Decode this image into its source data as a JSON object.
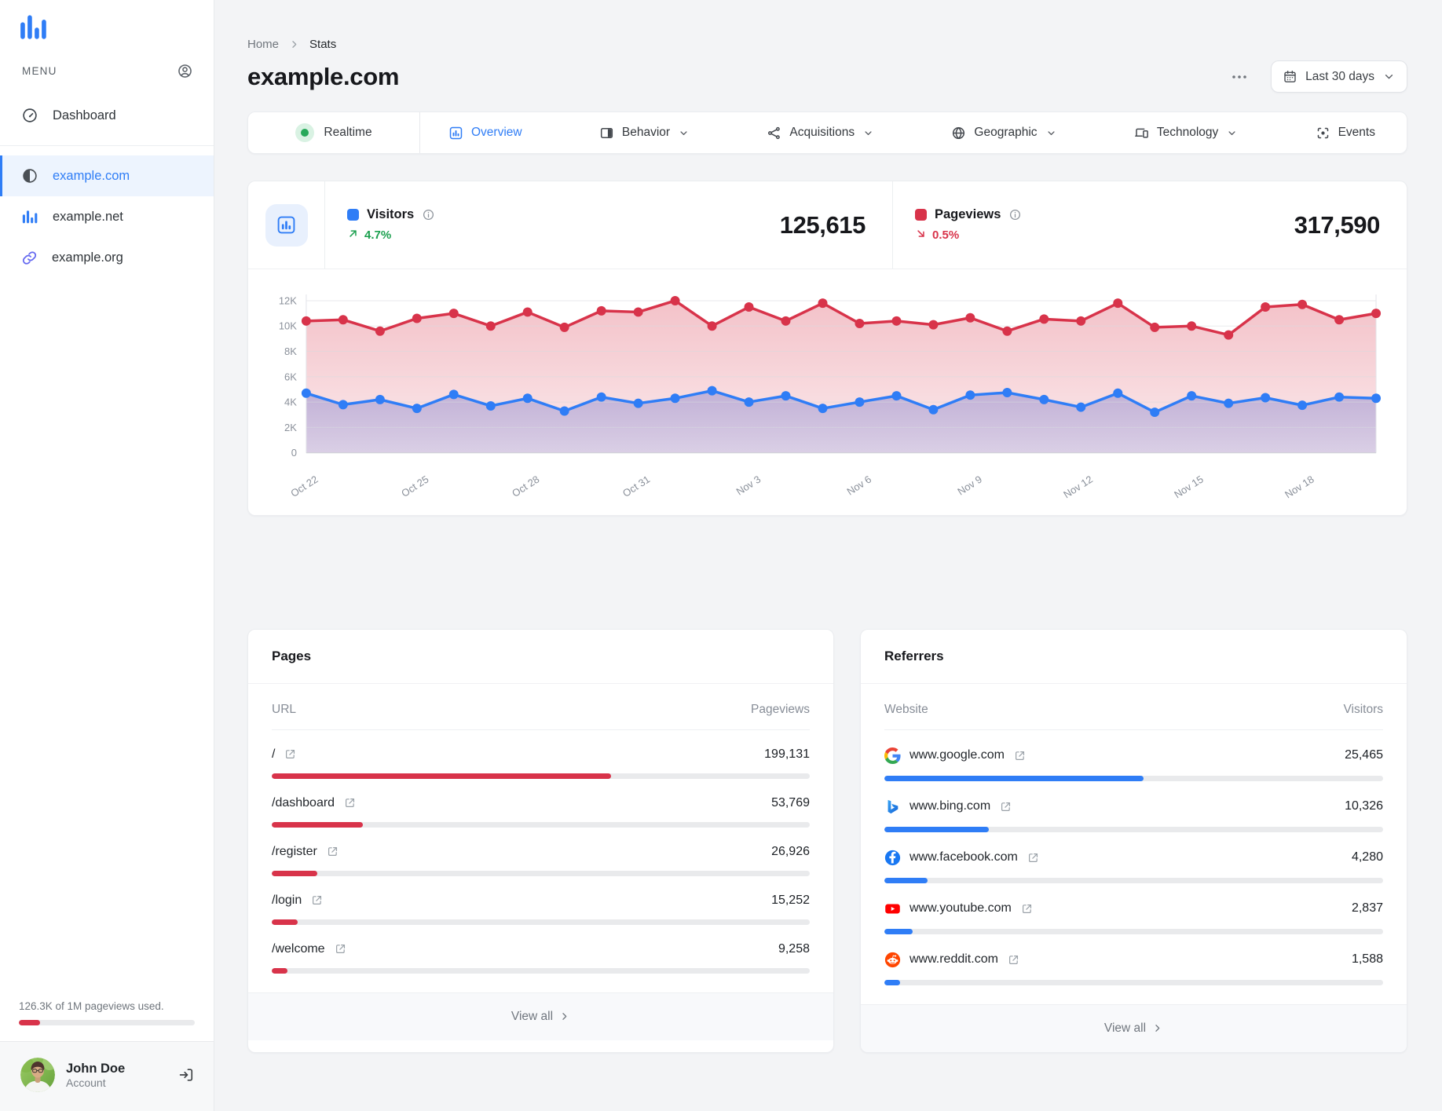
{
  "sidebar": {
    "menu_label": "MENU",
    "dashboard": "Dashboard",
    "sites": [
      {
        "label": "example.com",
        "icon": "contrast",
        "active": true
      },
      {
        "label": "example.net",
        "icon": "bar-chart",
        "active": false
      },
      {
        "label": "example.org",
        "icon": "link",
        "active": false
      }
    ],
    "usage_text": "126.3K of 1M pageviews used.",
    "usage_percent": 12,
    "account_name": "John Doe",
    "account_sub": "Account"
  },
  "breadcrumb": {
    "home": "Home",
    "current": "Stats"
  },
  "header": {
    "title": "example.com",
    "date_range": "Last 30 days"
  },
  "tabs": [
    {
      "label": "Realtime",
      "icon": "live",
      "active": false,
      "dropdown": false
    },
    {
      "label": "Overview",
      "icon": "overview",
      "active": true,
      "dropdown": false
    },
    {
      "label": "Behavior",
      "icon": "window",
      "active": false,
      "dropdown": true
    },
    {
      "label": "Acquisitions",
      "icon": "share",
      "active": false,
      "dropdown": true
    },
    {
      "label": "Geographic",
      "icon": "globe",
      "active": false,
      "dropdown": true
    },
    {
      "label": "Technology",
      "icon": "devices",
      "active": false,
      "dropdown": true
    },
    {
      "label": "Events",
      "icon": "scan",
      "active": false,
      "dropdown": false
    }
  ],
  "stats": {
    "visitors_label": "Visitors",
    "visitors_value": "125,615",
    "visitors_change": "4.7%",
    "visitors_direction": "up",
    "pageviews_label": "Pageviews",
    "pageviews_value": "317,590",
    "pageviews_change": "0.5%",
    "pageviews_direction": "down"
  },
  "chart_data": {
    "type": "line",
    "x": [
      "Oct 22",
      "Oct 23",
      "Oct 24",
      "Oct 25",
      "Oct 26",
      "Oct 27",
      "Oct 28",
      "Oct 29",
      "Oct 30",
      "Oct 31",
      "Nov 1",
      "Nov 2",
      "Nov 3",
      "Nov 4",
      "Nov 5",
      "Nov 6",
      "Nov 7",
      "Nov 8",
      "Nov 9",
      "Nov 10",
      "Nov 11",
      "Nov 12",
      "Nov 13",
      "Nov 14",
      "Nov 15",
      "Nov 16",
      "Nov 17",
      "Nov 18",
      "Nov 19",
      "Nov 20"
    ],
    "tick_every": 3,
    "series": [
      {
        "name": "Pageviews",
        "color": "#d8334a",
        "values": [
          10400,
          10500,
          9600,
          10600,
          11000,
          10000,
          11100,
          9900,
          11200,
          11100,
          12000,
          10000,
          11500,
          10400,
          11800,
          10200,
          10400,
          10100,
          10650,
          9600,
          10550,
          10400,
          11800,
          9900,
          10000,
          9300,
          11500,
          11700,
          10500,
          11000
        ]
      },
      {
        "name": "Visitors",
        "color": "#2f7df6",
        "values": [
          4700,
          3800,
          4200,
          3500,
          4600,
          3700,
          4300,
          3300,
          4400,
          3900,
          4300,
          4900,
          4000,
          4500,
          3500,
          4000,
          4500,
          3400,
          4550,
          4750,
          4200,
          3600,
          4700,
          3200,
          4500,
          3900,
          4350,
          3750,
          4400,
          4300
        ]
      }
    ],
    "ylim": [
      0,
      12000
    ],
    "yticks": [
      "0",
      "2K",
      "4K",
      "6K",
      "8K",
      "10K",
      "12K"
    ],
    "grid": "horizontal",
    "legend_position": "top-stat-headers"
  },
  "pages": {
    "title": "Pages",
    "columns": [
      "URL",
      "Pageviews"
    ],
    "rows": [
      {
        "label": "/",
        "value": "199,131",
        "bar_percent": 63
      },
      {
        "label": "/dashboard",
        "value": "53,769",
        "bar_percent": 17
      },
      {
        "label": "/register",
        "value": "26,926",
        "bar_percent": 8.5
      },
      {
        "label": "/login",
        "value": "15,252",
        "bar_percent": 4.8
      },
      {
        "label": "/welcome",
        "value": "9,258",
        "bar_percent": 2.9
      }
    ],
    "view_all": "View all"
  },
  "referrers": {
    "title": "Referrers",
    "columns": [
      "Website",
      "Visitors"
    ],
    "rows": [
      {
        "label": "www.google.com",
        "icon": "google",
        "value": "25,465",
        "bar_percent": 52
      },
      {
        "label": "www.bing.com",
        "icon": "bing",
        "value": "10,326",
        "bar_percent": 21
      },
      {
        "label": "www.facebook.com",
        "icon": "facebook",
        "value": "4,280",
        "bar_percent": 8.7
      },
      {
        "label": "www.youtube.com",
        "icon": "youtube",
        "value": "2,837",
        "bar_percent": 5.7
      },
      {
        "label": "www.reddit.com",
        "icon": "reddit",
        "value": "1,588",
        "bar_percent": 3.2
      }
    ],
    "view_all": "View all"
  },
  "colors": {
    "accent_blue": "#2f7df6",
    "accent_red": "#d8334a",
    "positive_green": "#1ca04f",
    "page_bg": "#f3f4f6"
  }
}
